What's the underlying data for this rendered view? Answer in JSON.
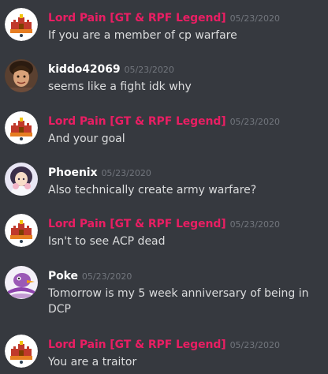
{
  "colors": {
    "background": "#36393f",
    "role_pink": "#e91e63",
    "username_white": "#ffffff",
    "timestamp": "#72767d",
    "message_text": "#dcddde"
  },
  "messages": [
    {
      "author": "Lord Pain [GT & RPF Legend]",
      "timestamp": "05/23/2020",
      "text": "If you are a member of cp warfare",
      "avatar": "castle-crest-icon",
      "role_color": "#e91e63"
    },
    {
      "author": "kiddo42069",
      "timestamp": "05/23/2020",
      "text": "seems like a fight idk why",
      "avatar": "photo-avatar",
      "role_color": "#ffffff"
    },
    {
      "author": "Lord Pain [GT & RPF Legend]",
      "timestamp": "05/23/2020",
      "text": "And your goal",
      "avatar": "castle-crest-icon",
      "role_color": "#e91e63"
    },
    {
      "author": "Phoenix",
      "timestamp": "05/23/2020",
      "text": "Also technically create army warfare?",
      "avatar": "anime-character-avatar",
      "role_color": "#ffffff"
    },
    {
      "author": "Lord Pain [GT & RPF Legend]",
      "timestamp": "05/23/2020",
      "text": "Isn't to see ACP dead",
      "avatar": "castle-crest-icon",
      "role_color": "#e91e63"
    },
    {
      "author": "Poke",
      "timestamp": "05/23/2020",
      "text": "Tomorrow is my 5 week anniversary of being in DCP",
      "avatar": "bird-character-avatar",
      "role_color": "#ffffff"
    },
    {
      "author": "Lord Pain [GT & RPF Legend]",
      "timestamp": "05/23/2020",
      "text": "You are a traitor",
      "avatar": "castle-crest-icon",
      "role_color": "#e91e63"
    }
  ]
}
